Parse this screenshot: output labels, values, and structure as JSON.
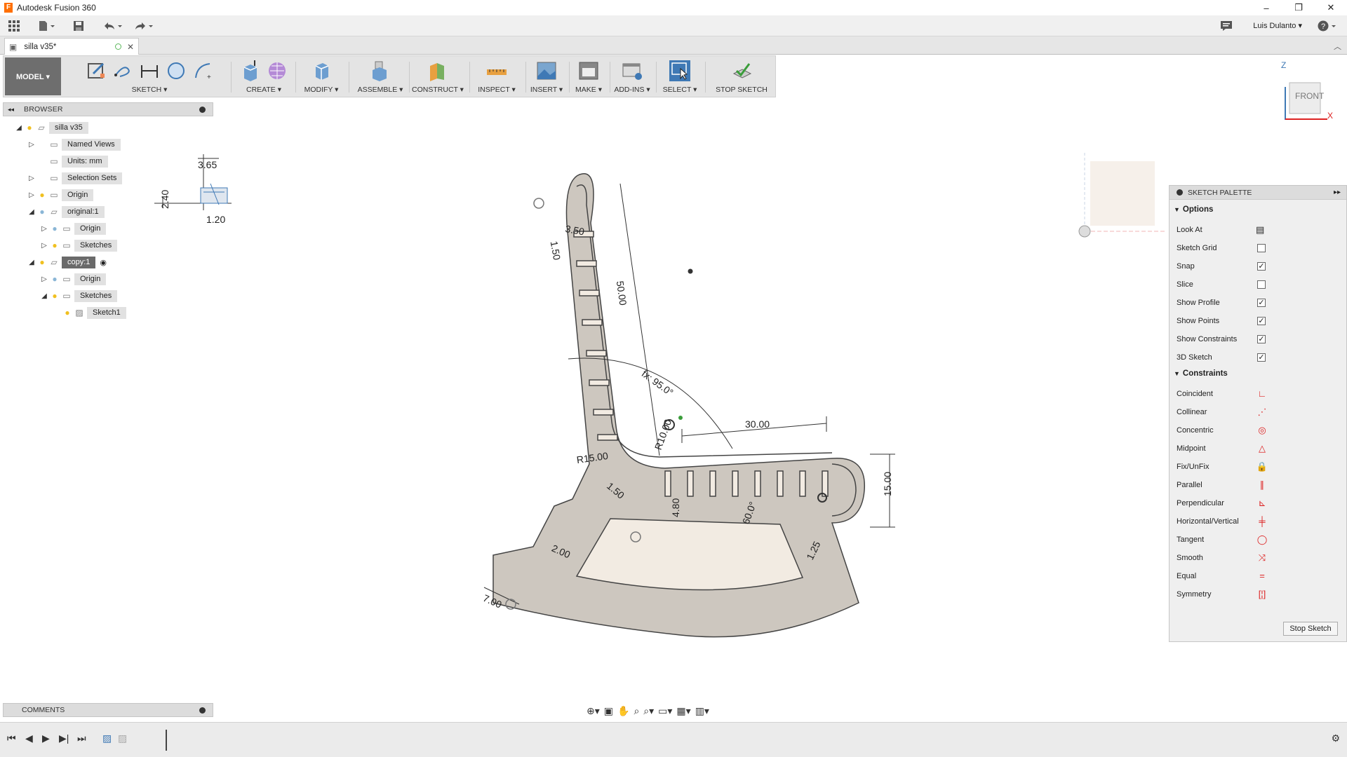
{
  "window": {
    "title": "Autodesk Fusion 360",
    "app_icon": "F",
    "minimize": "–",
    "restore": "❐",
    "close": "✕"
  },
  "quickbar": {
    "user": "Luis Dulanto ▾",
    "help": "?",
    "icons": [
      "grid-icon",
      "file-icon",
      "save-icon",
      "undo-icon",
      "redo-icon",
      "chat-icon",
      "help-icon"
    ]
  },
  "document": {
    "tab_label": "silla v35*",
    "close": "✕"
  },
  "toolbar": {
    "workspace": "MODEL ▾",
    "groups": [
      {
        "label": "SKETCH ▾"
      },
      {
        "label": "CREATE ▾"
      },
      {
        "label": "MODIFY ▾"
      },
      {
        "label": "ASSEMBLE ▾"
      },
      {
        "label": "CONSTRUCT ▾"
      },
      {
        "label": "INSPECT ▾"
      },
      {
        "label": "INSERT ▾"
      },
      {
        "label": "MAKE ▾"
      },
      {
        "label": "ADD-INS ▾"
      },
      {
        "label": "SELECT ▾"
      },
      {
        "label": "STOP SKETCH"
      }
    ]
  },
  "browser": {
    "title": "BROWSER",
    "collapse": "◂◂",
    "nodes": [
      {
        "label": "silla v35"
      },
      {
        "label": "Named Views"
      },
      {
        "label": "Units: mm"
      },
      {
        "label": "Selection Sets"
      },
      {
        "label": "Origin"
      },
      {
        "label": "original:1"
      },
      {
        "label": "Origin"
      },
      {
        "label": "Sketches"
      },
      {
        "label": "copy:1"
      },
      {
        "label": "Origin"
      },
      {
        "label": "Sketches"
      },
      {
        "label": "Sketch1"
      }
    ]
  },
  "comments": {
    "title": "COMMENTS"
  },
  "viewcube": {
    "face": "FRONT",
    "axis_z": "Z",
    "axis_x": "X"
  },
  "canvas": {
    "dimensions": [
      "3.65",
      "2.40",
      "1.20",
      "50.00",
      "30.00",
      "15.00",
      "R15.00",
      "R10.00",
      "fx: 95.0°",
      "1.50",
      "4.80",
      "7.00",
      "2.00",
      "1.25",
      "60.0°",
      "3.50",
      "1.50"
    ]
  },
  "palette": {
    "title": "SKETCH PALETTE",
    "options_header": "Options",
    "options": [
      {
        "label": "Look At",
        "type": "icon",
        "icon": "look-at-icon"
      },
      {
        "label": "Sketch Grid",
        "type": "checkbox",
        "checked": false
      },
      {
        "label": "Snap",
        "type": "checkbox",
        "checked": true
      },
      {
        "label": "Slice",
        "type": "checkbox",
        "checked": false
      },
      {
        "label": "Show Profile",
        "type": "checkbox",
        "checked": true
      },
      {
        "label": "Show Points",
        "type": "checkbox",
        "checked": true
      },
      {
        "label": "Show Constraints",
        "type": "checkbox",
        "checked": true
      },
      {
        "label": "3D Sketch",
        "type": "checkbox",
        "checked": true
      }
    ],
    "constraints_header": "Constraints",
    "constraints": [
      {
        "label": "Coincident",
        "glyph": "∟"
      },
      {
        "label": "Collinear",
        "glyph": "⋰"
      },
      {
        "label": "Concentric",
        "glyph": "◎"
      },
      {
        "label": "Midpoint",
        "glyph": "△"
      },
      {
        "label": "Fix/UnFix",
        "glyph": "🔒"
      },
      {
        "label": "Parallel",
        "glyph": "∥"
      },
      {
        "label": "Perpendicular",
        "glyph": "⊾"
      },
      {
        "label": "Horizontal/Vertical",
        "glyph": "╪"
      },
      {
        "label": "Tangent",
        "glyph": "◯"
      },
      {
        "label": "Smooth",
        "glyph": "⤨"
      },
      {
        "label": "Equal",
        "glyph": "="
      },
      {
        "label": "Symmetry",
        "glyph": "[¦]"
      }
    ],
    "stop_button": "Stop Sketch"
  },
  "colors": {
    "sketch_fill": "#cdc7bf",
    "profile_fill": "#f2ebe2",
    "toolbar_bg": "#e4e4e4",
    "workspace_btn": "#6e6e6e",
    "select_active": "#3f79b5"
  }
}
